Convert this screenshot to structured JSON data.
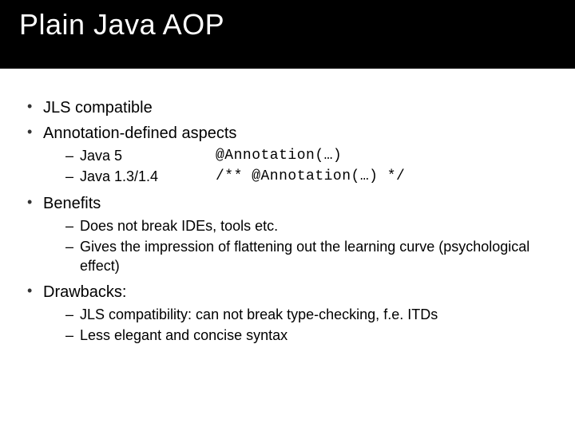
{
  "title": "Plain Java AOP",
  "bullets": {
    "b1": "JLS compatible",
    "b2": "Annotation-defined aspects",
    "b2_sub": {
      "s1_label": "Java 5",
      "s1_code": "@Annotation(…)",
      "s2_label": "Java 1.3/1.4",
      "s2_code": "/** @Annotation(…) */"
    },
    "b3": "Benefits",
    "b3_sub": {
      "s1": "Does not break IDEs, tools etc.",
      "s2": "Gives the impression of flattening out the learning curve (psychological effect)"
    },
    "b4": "Drawbacks:",
    "b4_sub": {
      "s1": "JLS compatibility: can not break type-checking, f.e. ITDs",
      "s2": "Less elegant and concise syntax"
    }
  }
}
